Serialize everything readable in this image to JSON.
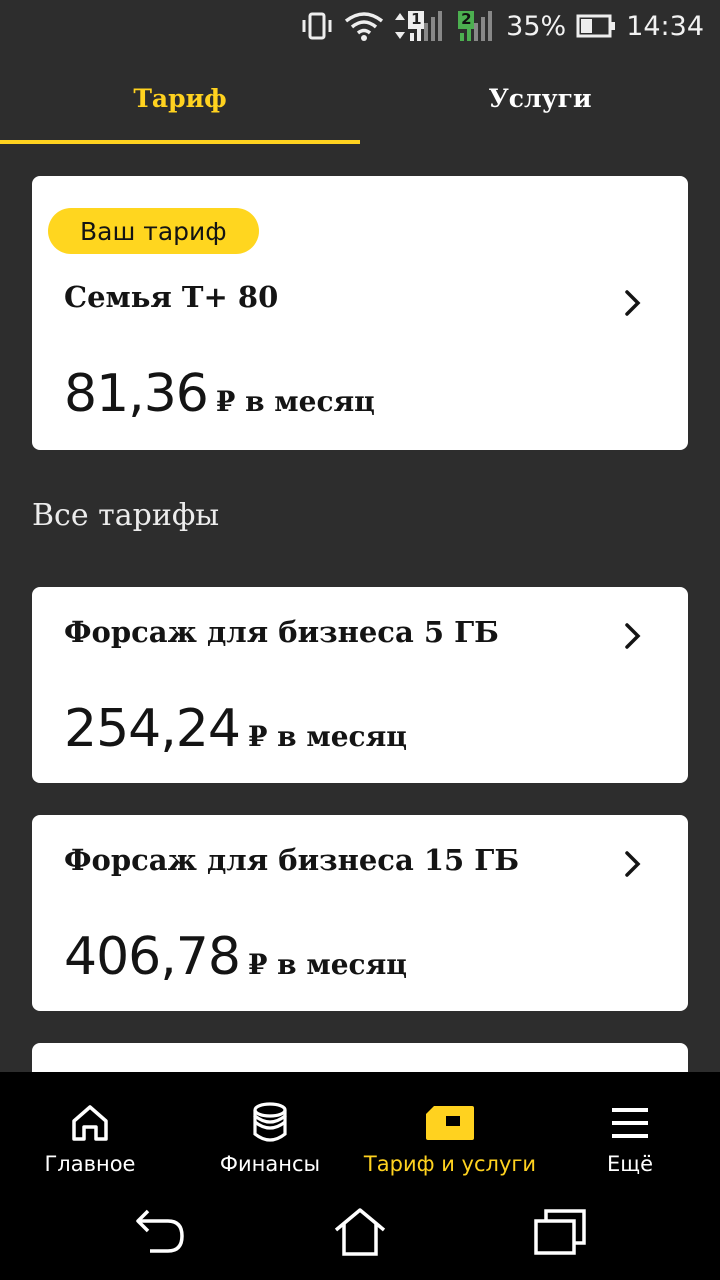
{
  "status_bar": {
    "battery_percent": "35%",
    "time": "14:34",
    "sim1_label": "1",
    "sim2_label": "2",
    "icons": [
      "vibrate-icon",
      "wifi-icon",
      "signal-sim1-icon",
      "signal-sim2-icon",
      "battery-icon"
    ]
  },
  "tabs": [
    {
      "label": "Тариф",
      "active": true
    },
    {
      "label": "Услуги",
      "active": false
    }
  ],
  "current_tariff": {
    "badge": "Ваш тариф",
    "name": "Семья Т+ 80",
    "price": "81,36",
    "price_unit": "₽ в месяц"
  },
  "all_tariffs_title": "Все тарифы",
  "tariffs": [
    {
      "name": "Форсаж для бизнеса 5 ГБ",
      "price": "254,24",
      "price_unit": "₽ в месяц"
    },
    {
      "name": "Форсаж для бизнеса 15 ГБ",
      "price": "406,78",
      "price_unit": "₽ в месяц"
    }
  ],
  "bottom_nav": [
    {
      "label": "Главное",
      "icon": "home-icon",
      "active": false
    },
    {
      "label": "Финансы",
      "icon": "coins-icon",
      "active": false
    },
    {
      "label": "Тариф и услуги",
      "icon": "sim-card-icon",
      "active": true
    },
    {
      "label": "Ещё",
      "icon": "menu-icon",
      "active": false
    }
  ],
  "system_nav": [
    "back-icon",
    "home-outline-icon",
    "recent-apps-icon"
  ],
  "colors": {
    "accent": "#ffd21f",
    "background": "#2d2d2d",
    "card": "#ffffff",
    "nav_background": "#000000"
  }
}
